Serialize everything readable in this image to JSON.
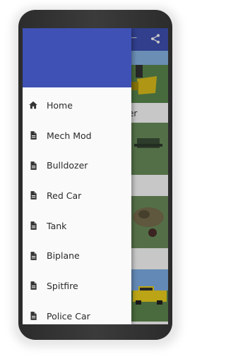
{
  "appbar": {
    "title": "—",
    "share_icon": "share-icon"
  },
  "content": {
    "caption": "er"
  },
  "drawer": {
    "items": [
      {
        "label": "Home",
        "icon": "home-icon"
      },
      {
        "label": "Mech Mod",
        "icon": "document-icon"
      },
      {
        "label": "Bulldozer",
        "icon": "document-icon"
      },
      {
        "label": "Red Car",
        "icon": "document-icon"
      },
      {
        "label": "Tank",
        "icon": "document-icon"
      },
      {
        "label": "Biplane",
        "icon": "document-icon"
      },
      {
        "label": "Spitfire",
        "icon": "document-icon"
      },
      {
        "label": "Police Car",
        "icon": "document-icon"
      }
    ]
  },
  "colors": {
    "primary": "#3f51b5",
    "drawer_bg": "#fafafa",
    "text": "#2a2a2a"
  }
}
